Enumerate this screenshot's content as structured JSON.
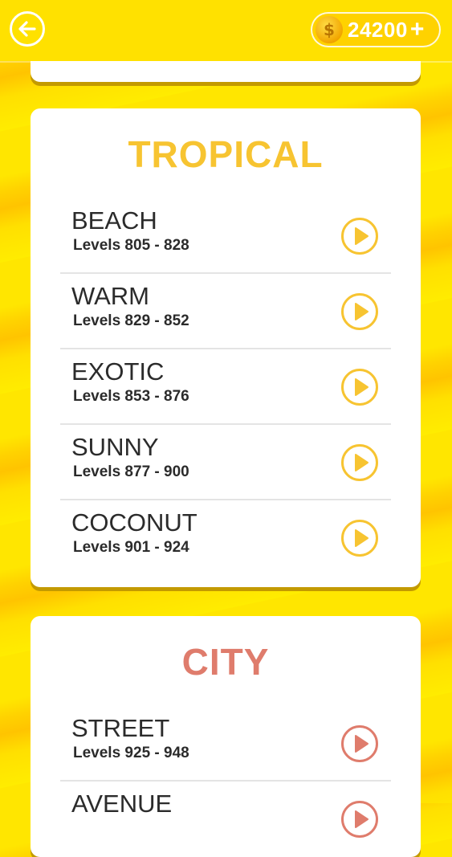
{
  "header": {
    "coins": "24200",
    "add_symbol": "+",
    "coin_symbol": "$"
  },
  "colors": {
    "tropical_accent": "#f7c431",
    "city_accent": "#df7c6c",
    "text": "#2b2b2b"
  },
  "icons": {
    "back": "back-arrow-icon",
    "coin": "coin-icon",
    "play": "play-icon"
  },
  "sections": [
    {
      "title": "TROPICAL",
      "items": [
        {
          "name": "BEACH",
          "levels": "Levels 805 - 828"
        },
        {
          "name": "WARM",
          "levels": "Levels 829 - 852"
        },
        {
          "name": "EXOTIC",
          "levels": "Levels 853 - 876"
        },
        {
          "name": "SUNNY",
          "levels": "Levels 877 - 900"
        },
        {
          "name": "COCONUT",
          "levels": "Levels 901 - 924"
        }
      ]
    },
    {
      "title": "CITY",
      "items": [
        {
          "name": "STREET",
          "levels": "Levels 925 - 948"
        },
        {
          "name": "AVENUE",
          "levels": ""
        }
      ]
    }
  ]
}
